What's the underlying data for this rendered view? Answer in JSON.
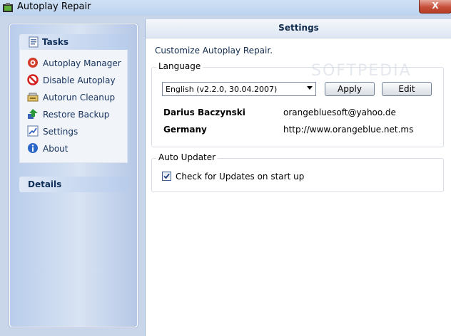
{
  "window": {
    "title": "Autoplay Repair",
    "close_label": "X"
  },
  "tasks_panel": {
    "title": "Tasks",
    "items": [
      {
        "label": "Autoplay Manager",
        "icon": "autoplay-manager-icon"
      },
      {
        "label": "Disable Autoplay",
        "icon": "disable-icon"
      },
      {
        "label": "Autorun Cleanup",
        "icon": "cleanup-icon"
      },
      {
        "label": "Restore Backup",
        "icon": "restore-icon"
      },
      {
        "label": "Settings",
        "icon": "settings-icon"
      },
      {
        "label": "About",
        "icon": "info-icon"
      }
    ]
  },
  "details_panel": {
    "title": "Details"
  },
  "settings": {
    "header": "Settings",
    "description": "Customize Autoplay Repair.",
    "language_group": "Language",
    "language_value": "English (v2.2.0, 30.04.2007)",
    "apply_label": "Apply",
    "edit_label": "Edit",
    "author_name": "Darius Baczynski",
    "author_email": "orangebluesoft@yahoo.de",
    "country": "Germany",
    "website": "http://www.orangeblue.net.ms",
    "updater_group": "Auto Updater",
    "updater_checkbox_label": "Check for Updates on start up",
    "updater_checked": true
  },
  "watermark": "SOFTPEDIA"
}
